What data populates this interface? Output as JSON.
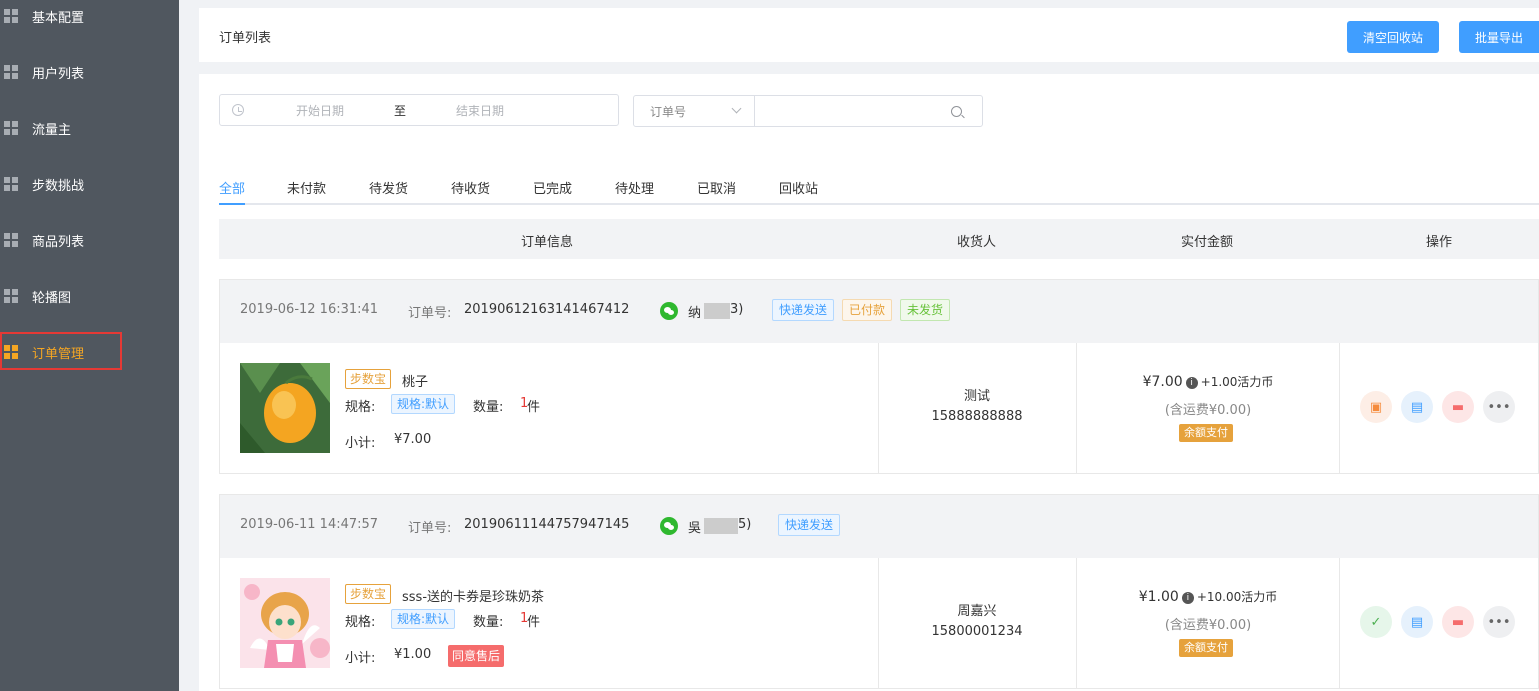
{
  "sidebar": {
    "items": [
      {
        "label": "基本配置"
      },
      {
        "label": "用户列表"
      },
      {
        "label": "流量主"
      },
      {
        "label": "步数挑战"
      },
      {
        "label": "商品列表"
      },
      {
        "label": "轮播图"
      },
      {
        "label": "订单管理",
        "active": true
      }
    ]
  },
  "header": {
    "title": "订单列表",
    "clear_recycle": "清空回收站",
    "batch_export": "批量导出"
  },
  "filters": {
    "start_placeholder": "开始日期",
    "range_sep": "至",
    "end_placeholder": "结束日期",
    "select_value": "订单号",
    "search_placeholder": ""
  },
  "tabs": [
    "全部",
    "未付款",
    "待发货",
    "待收货",
    "已完成",
    "待处理",
    "已取消",
    "回收站"
  ],
  "table_headers": {
    "info": "订单信息",
    "receiver": "收货人",
    "paid": "实付金额",
    "ops": "操作"
  },
  "orders": [
    {
      "date": "2019-06-12 16:31:41",
      "order_no_label": "订单号:",
      "order_no": "20190612163141467412",
      "buyer_prefix": "纳",
      "buyer_suffix": "3)",
      "tags": [
        "快递发送",
        "已付款",
        "未发货"
      ],
      "product_tag": "步数宝",
      "product_name": "桃子",
      "spec_label": "规格:",
      "spec_value": "规格:默认",
      "qty_label": "数量:",
      "qty": "1",
      "qty_unit": "件",
      "subtotal_label": "小计:",
      "subtotal": "¥7.00",
      "after_sale": "",
      "receiver_name": "测试",
      "receiver_phone": "15888888888",
      "amount": "¥7.00",
      "coin": "+1.00活力币",
      "shipping": "(含运费¥0.00)",
      "pay_method": "余额支付"
    },
    {
      "date": "2019-06-11 14:47:57",
      "order_no_label": "订单号:",
      "order_no": "20190611144757947145",
      "buyer_prefix": "吳",
      "buyer_suffix": "5)",
      "tags": [
        "快递发送"
      ],
      "product_tag": "步数宝",
      "product_name": "sss-送的卡券是珍珠奶茶",
      "spec_label": "规格:",
      "spec_value": "规格:默认",
      "qty_label": "数量:",
      "qty": "1",
      "qty_unit": "件",
      "subtotal_label": "小计:",
      "subtotal": "¥1.00",
      "after_sale": "同意售后",
      "receiver_name": "周嘉兴",
      "receiver_phone": "15800001234",
      "amount": "¥1.00",
      "coin": "+10.00活力币",
      "shipping": "(含运费¥0.00)",
      "pay_method": "余额支付"
    }
  ],
  "icons": {
    "ship": "ship-icon",
    "print": "print-icon",
    "message": "message-icon",
    "more": "more-icon",
    "check": "check-clipboard-icon"
  },
  "colors": {
    "accent": "#409eff",
    "sidebar_bg": "#50575f",
    "active": "#f5a623"
  }
}
